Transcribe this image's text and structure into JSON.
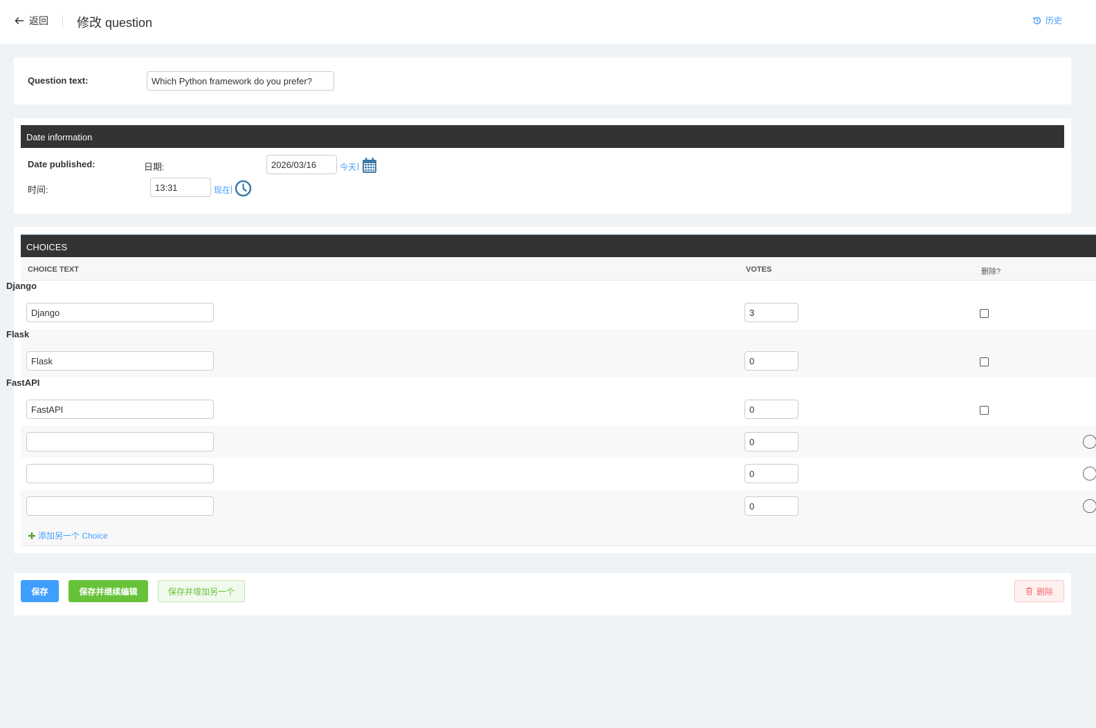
{
  "header": {
    "back_label": "返回",
    "title": "修改 question",
    "history_label": "历史"
  },
  "question": {
    "label": "Question text:",
    "value": "Which Python framework do you prefer?"
  },
  "date_info": {
    "section_title": "Date information",
    "date_published_label": "Date published:",
    "date_label": "日期:",
    "date_value": "2026/03/16",
    "today_link": "今天",
    "separator": "|",
    "time_label": "时间:",
    "time_value": "13:31",
    "now_link": "现在"
  },
  "choices": {
    "section_title": "CHOICES",
    "columns": {
      "choice_text": "CHOICE TEXT",
      "votes": "VOTES",
      "delete": "删除?"
    },
    "rows": [
      {
        "label": "Django",
        "text": "Django",
        "votes": "3"
      },
      {
        "label": "Flask",
        "text": "Flask",
        "votes": "0"
      },
      {
        "label": "FastAPI",
        "text": "FastAPI",
        "votes": "0"
      }
    ],
    "extra_rows": [
      {
        "text": "",
        "votes": "0"
      },
      {
        "text": "",
        "votes": "0"
      },
      {
        "text": "",
        "votes": "0"
      }
    ],
    "add_another": "添加另一个 Choice"
  },
  "actions": {
    "save": "保存",
    "save_continue": "保存并继续编辑",
    "save_add": "保存并增加另一个",
    "delete": "删除"
  },
  "colors": {
    "accent": "#409eff",
    "success": "#67c23a",
    "danger": "#f56c6c",
    "dark_header": "#333333",
    "icon_blue": "#3a79a8"
  },
  "icons": [
    "arrow-left-icon",
    "history-icon",
    "calendar-icon",
    "clock-icon",
    "plus-icon",
    "trash-icon"
  ]
}
